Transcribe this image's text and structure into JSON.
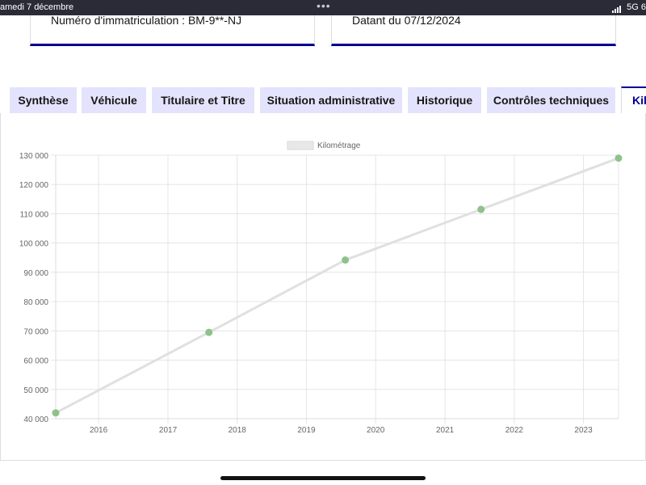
{
  "status_bar": {
    "date": "amedi 7 décembre",
    "dots": "•••",
    "network": "5G",
    "battery_fragment": "6"
  },
  "cards": {
    "registration": "Numéro d'immatriculation : BM-9**-NJ",
    "date": "Datant du 07/12/2024"
  },
  "tabs": [
    {
      "label": "Synthèse",
      "active": false
    },
    {
      "label": "Véhicule",
      "active": false
    },
    {
      "label": "Titulaire et Titre",
      "active": false
    },
    {
      "label": "Situation administrative",
      "active": false
    },
    {
      "label": "Historique",
      "active": false
    },
    {
      "label": "Contrôles techniques",
      "active": false
    },
    {
      "label": "Kil",
      "active": true
    }
  ],
  "colors": {
    "tab_background": "#e3e3fd",
    "accent": "#000091",
    "line": "#e0e0e0",
    "point": "#8fc28a",
    "grid": "#e5e5e5"
  },
  "chart_data": {
    "type": "line",
    "title": "",
    "xlabel": "",
    "ylabel": "",
    "legend": {
      "label": "Kilométrage",
      "position": "top"
    },
    "grid": true,
    "xlim": [
      "2015-05-20",
      "2023-07-05"
    ],
    "ylim": [
      40000,
      130000
    ],
    "x_ticks": [
      "2016",
      "2017",
      "2018",
      "2019",
      "2020",
      "2021",
      "2022",
      "2023"
    ],
    "y_ticks": [
      "40 000",
      "50 000",
      "60 000",
      "70 000",
      "80 000",
      "90 000",
      "100 000",
      "110 000",
      "120 000",
      "130 000"
    ],
    "series": [
      {
        "name": "Kilométrage",
        "points": [
          {
            "x": "2015-05-20",
            "y": 42000
          },
          {
            "x": "2017-08-05",
            "y": 69500
          },
          {
            "x": "2019-07-25",
            "y": 94200
          },
          {
            "x": "2021-07-10",
            "y": 111500
          },
          {
            "x": "2023-07-05",
            "y": 129000
          }
        ]
      }
    ]
  }
}
